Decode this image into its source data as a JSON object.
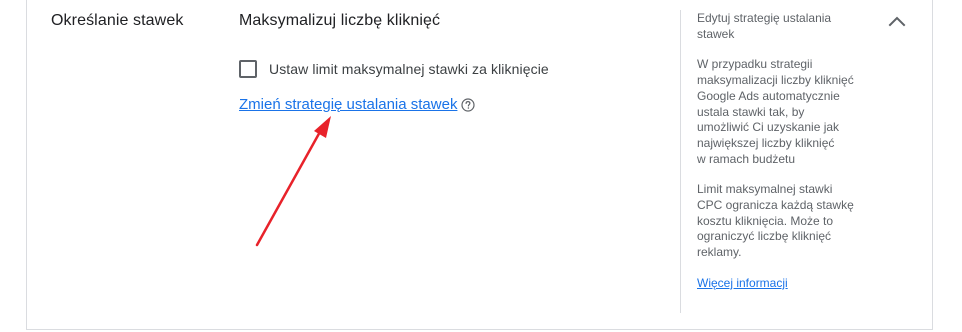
{
  "section": {
    "title": "Określanie stawek"
  },
  "strategy": {
    "title": "Maksymalizuj liczbę kliknięć",
    "checkbox_label": "Ustaw limit maksymalnej stawki za kliknięcie",
    "checkbox_checked": false,
    "change_link": "Zmień strategię ustalania stawek"
  },
  "side_panel": {
    "title": "Edytuj strategię ustalania\nstawek",
    "paragraph1": "W przypadku strategii\nmaksymalizacji liczby kliknięć\nGoogle Ads automatycznie\nustala stawki tak, by\numożliwić Ci uzyskanie jak\nnajwiększej liczby kliknięć\nw ramach budżetu",
    "paragraph2": "Limit maksymalnej stawki\nCPC ogranicza każdą stawkę\nkosztu kliknięcia. Może to\nograniczyć liczbę kliknięć\nreklamy.",
    "more_link": "Więcej informacji"
  },
  "annotation": {
    "arrow_color": "#e8222a"
  },
  "icons": {
    "help": "help-circle-icon",
    "collapse": "chevron-up-icon"
  },
  "colors": {
    "link": "#1a73e8",
    "text_primary": "#202124",
    "text_secondary": "#5f6368",
    "border": "#dadce0"
  }
}
